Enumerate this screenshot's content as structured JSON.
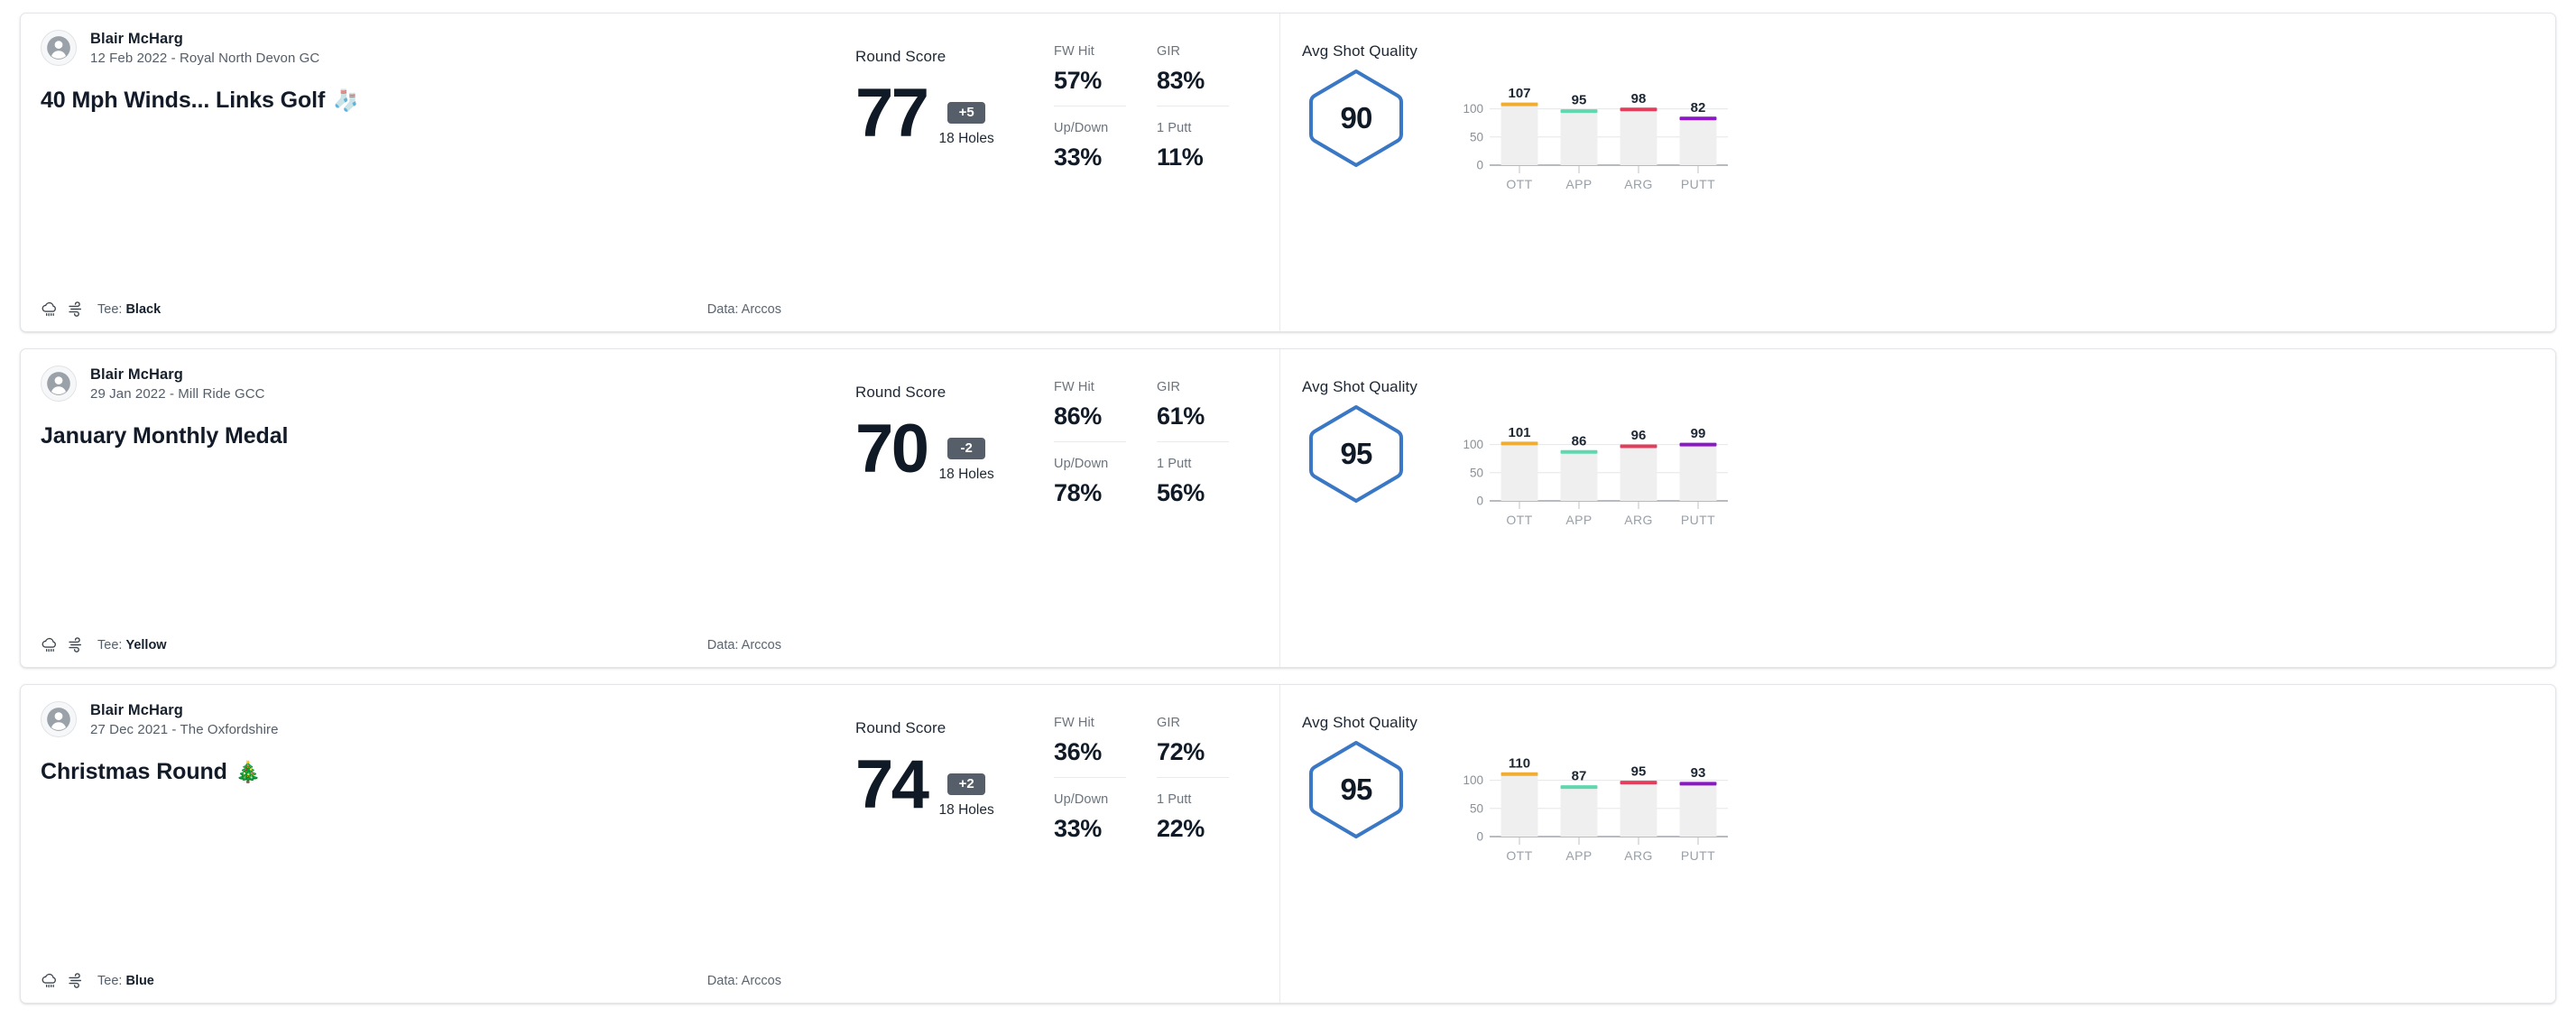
{
  "labels": {
    "round_score": "Round Score",
    "holes": "18 Holes",
    "avg_shot_quality": "Avg Shot Quality",
    "fw_hit": "FW Hit",
    "gir": "GIR",
    "up_down": "Up/Down",
    "one_putt": "1 Putt",
    "tee_prefix": "Tee:",
    "data_source": "Data: Arccos"
  },
  "chart_axis": {
    "y_ticks": [
      "100",
      "50",
      "0"
    ],
    "categories": [
      "OTT",
      "APP",
      "ARG",
      "PUTT"
    ],
    "ylim": [
      0,
      125
    ]
  },
  "colors": {
    "ott": "#f0ad33",
    "app": "#5fd8b0",
    "arg": "#e23e5c",
    "putt": "#8b18c4",
    "hexagon": "#3a77c4",
    "to_par_badge": "#565e69"
  },
  "cards": [
    {
      "player": "Blair McHarg",
      "meta": "12 Feb 2022 - Royal North Devon GC",
      "title": "40 Mph Winds... Links Golf",
      "title_emoji": "🧦",
      "tee": "Black",
      "data_source": "Data: Arccos",
      "score": "77",
      "to_par": "+5",
      "holes": "18 Holes",
      "stats": {
        "fw_hit": "57%",
        "gir": "83%",
        "up_down": "33%",
        "one_putt": "11%"
      },
      "avg_quality": "90",
      "chart_data": {
        "type": "bar",
        "title": "Avg Shot Quality",
        "categories": [
          "OTT",
          "APP",
          "ARG",
          "PUTT"
        ],
        "values": [
          107,
          95,
          98,
          82
        ],
        "colors": [
          "#f0ad33",
          "#5fd8b0",
          "#e23e5c",
          "#8b18c4"
        ],
        "ylabel": "",
        "xlabel": "",
        "ylim": [
          0,
          125
        ],
        "y_ticks": [
          0,
          50,
          100
        ],
        "grid": true,
        "legend": "none"
      }
    },
    {
      "player": "Blair McHarg",
      "meta": "29 Jan 2022 - Mill Ride GCC",
      "title": "January Monthly Medal",
      "title_emoji": "",
      "tee": "Yellow",
      "data_source": "Data: Arccos",
      "score": "70",
      "to_par": "-2",
      "holes": "18 Holes",
      "stats": {
        "fw_hit": "86%",
        "gir": "61%",
        "up_down": "78%",
        "one_putt": "56%"
      },
      "avg_quality": "95",
      "chart_data": {
        "type": "bar",
        "title": "Avg Shot Quality",
        "categories": [
          "OTT",
          "APP",
          "ARG",
          "PUTT"
        ],
        "values": [
          101,
          86,
          96,
          99
        ],
        "colors": [
          "#f0ad33",
          "#5fd8b0",
          "#e23e5c",
          "#8b18c4"
        ],
        "ylabel": "",
        "xlabel": "",
        "ylim": [
          0,
          125
        ],
        "y_ticks": [
          0,
          50,
          100
        ],
        "grid": true,
        "legend": "none"
      }
    },
    {
      "player": "Blair McHarg",
      "meta": "27 Dec 2021 - The Oxfordshire",
      "title": "Christmas Round",
      "title_emoji": "🎄",
      "tee": "Blue",
      "data_source": "Data: Arccos",
      "score": "74",
      "to_par": "+2",
      "holes": "18 Holes",
      "stats": {
        "fw_hit": "36%",
        "gir": "72%",
        "up_down": "33%",
        "one_putt": "22%"
      },
      "avg_quality": "95",
      "chart_data": {
        "type": "bar",
        "title": "Avg Shot Quality",
        "categories": [
          "OTT",
          "APP",
          "ARG",
          "PUTT"
        ],
        "values": [
          110,
          87,
          95,
          93
        ],
        "colors": [
          "#f0ad33",
          "#5fd8b0",
          "#e23e5c",
          "#8b18c4"
        ],
        "ylabel": "",
        "xlabel": "",
        "ylim": [
          0,
          125
        ],
        "y_ticks": [
          0,
          50,
          100
        ],
        "grid": true,
        "legend": "none"
      }
    }
  ]
}
